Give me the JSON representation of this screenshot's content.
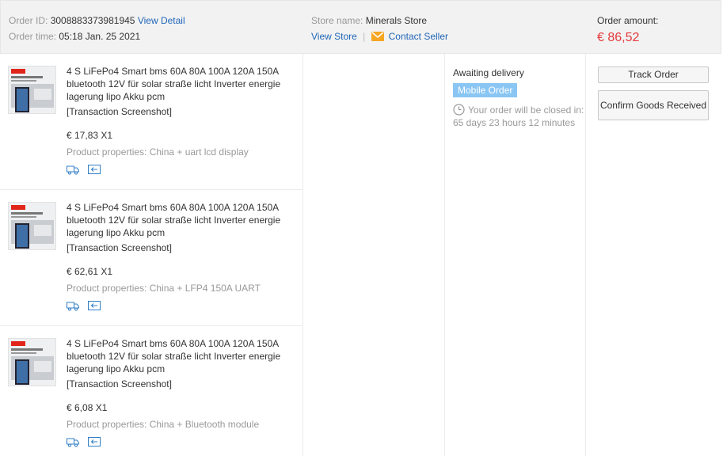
{
  "order": {
    "id_label": "Order ID:",
    "id_value": "3008883373981945",
    "view_detail": "View Detail",
    "time_label": "Order time:",
    "time_value": "05:18 Jan. 25 2021",
    "store_label": "Store name:",
    "store_value": "Minerals Store",
    "view_store": "View Store",
    "separator": "|",
    "contact_seller": "Contact Seller",
    "amount_label": "Order amount:",
    "amount_value": "€ 86,52"
  },
  "products": [
    {
      "title": "4 S LiFePo4 Smart bms 60A 80A 100A 120A 150A bluetooth 12V für solar straße licht Inverter energie lagerung lipo Akku pcm",
      "screenshot": "[Transaction Screenshot]",
      "price": "€ 17,83 X1",
      "properties": "Product properties: China + uart lcd display"
    },
    {
      "title": "4 S LiFePo4 Smart bms 60A 80A 100A 120A 150A bluetooth 12V für solar straße licht Inverter energie lagerung lipo Akku pcm",
      "screenshot": "[Transaction Screenshot]",
      "price": "€ 62,61 X1",
      "properties": "Product properties: China + LFP4 150A UART"
    },
    {
      "title": "4 S LiFePo4 Smart bms 60A 80A 100A 120A 150A bluetooth 12V für solar straße licht Inverter energie lagerung lipo Akku pcm",
      "screenshot": "[Transaction Screenshot]",
      "price": "€ 6,08 X1",
      "properties": "Product properties: China + Bluetooth module"
    }
  ],
  "status": {
    "text": "Awaiting delivery",
    "tag": "Mobile Order",
    "closing": "Your order will be closed in: 65 days 23 hours 12 minutes"
  },
  "actions": {
    "track": "Track Order",
    "confirm": "Confirm Goods Received"
  },
  "icons": {
    "mail": "mail-icon",
    "clock": "clock-icon",
    "shipping": "shipping-truck-icon",
    "return": "return-arrow-icon"
  },
  "colors": {
    "link": "#2066b8",
    "amount": "#e4393c",
    "mobile_tag": "#8ac6f4",
    "header_bg": "#f2f2f2"
  }
}
